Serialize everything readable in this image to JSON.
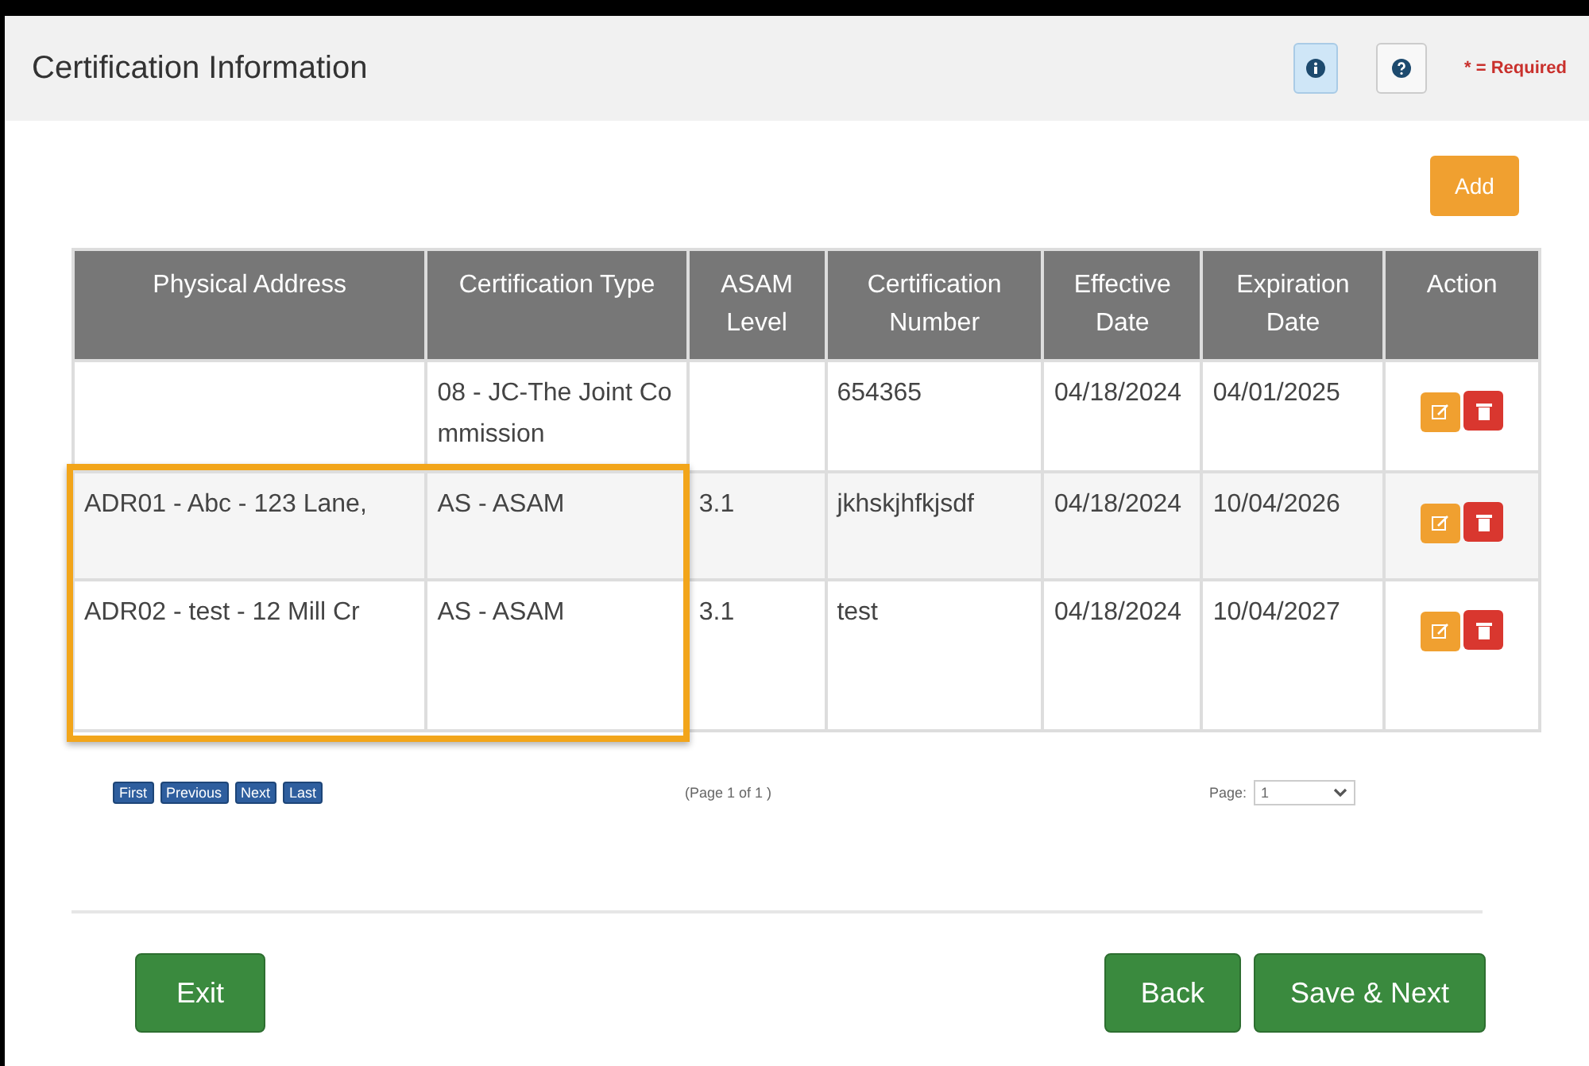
{
  "header": {
    "title": "Certification Information",
    "tools": [
      {
        "kind": "info",
        "selected": true
      },
      {
        "kind": "help",
        "selected": false
      }
    ],
    "required_note": "* = Required"
  },
  "add_button": "Add",
  "table": {
    "columns": [
      "Physical Address",
      "Certification Type",
      "ASAM Level",
      "Certification Number",
      "Effective Date",
      "Expiration Date",
      "Action"
    ],
    "rows": [
      {
        "cells": [
          "",
          "08 - JC-The Joint Commission",
          "",
          "654365",
          "04/18/2024",
          "04/01/2025"
        ],
        "highlighted": false
      },
      {
        "cells": [
          "ADR01 - Abc - 123 Lane,",
          "AS - ASAM",
          "3.1",
          "jkhskjhfkjsdf",
          "04/18/2024",
          "10/04/2026"
        ],
        "highlighted": true
      },
      {
        "cells": [
          "ADR02 - test - 12 Mill Cr",
          "AS - ASAM",
          "3.1",
          "test",
          "04/18/2024",
          "10/04/2027"
        ],
        "highlighted": true
      }
    ]
  },
  "pager": {
    "buttons": [
      "First",
      "Previous",
      "Next",
      "Last"
    ],
    "info": "(Page 1 of 1 )",
    "page_label": "Page:",
    "page_value": "1"
  },
  "footer": {
    "left": [
      "Exit"
    ],
    "right": [
      "Back",
      "Save & Next"
    ]
  }
}
